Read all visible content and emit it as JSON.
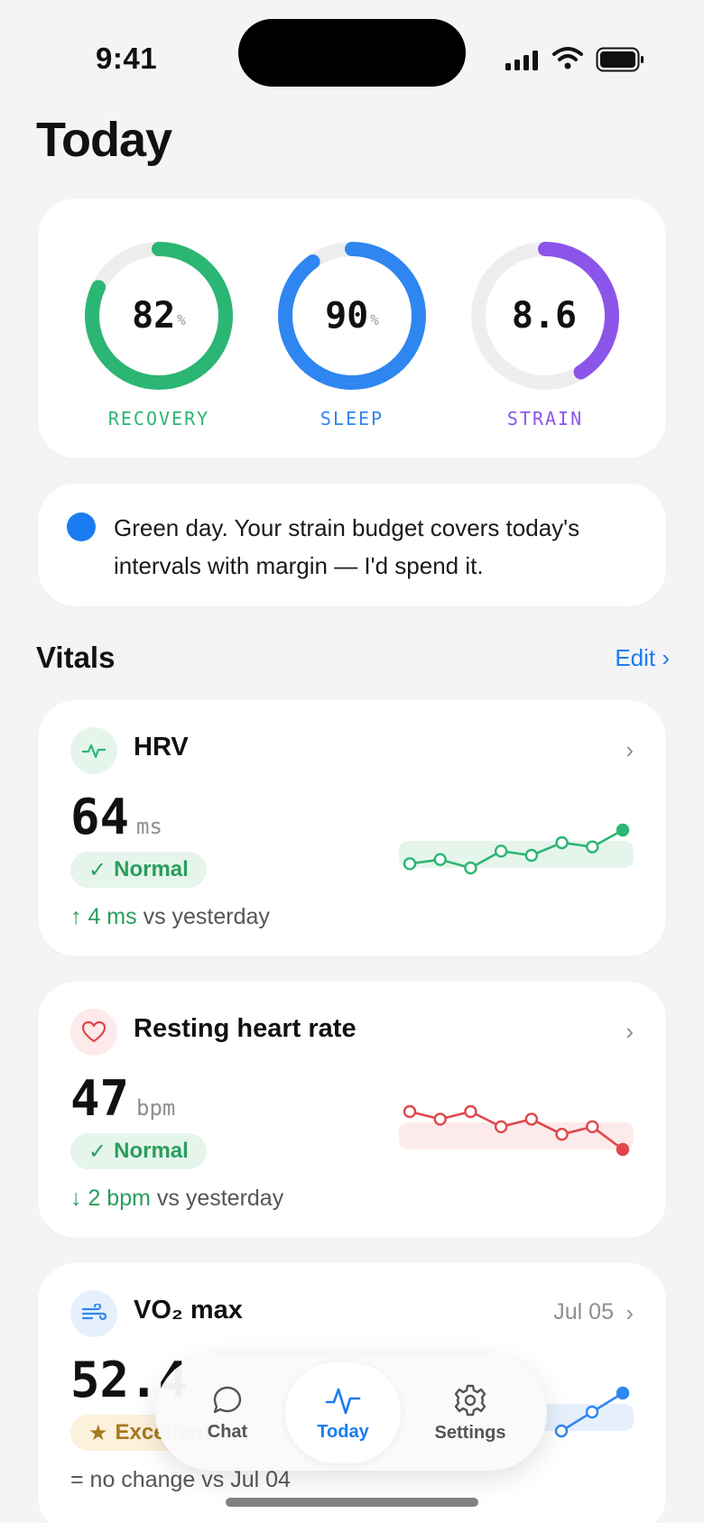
{
  "status_bar": {
    "time": "9:41"
  },
  "page_title": "Today",
  "rings": [
    {
      "value": "82",
      "unit": "%",
      "label": "RECOVERY",
      "progress": 0.82,
      "color": "#2bb673"
    },
    {
      "value": "90",
      "unit": "%",
      "label": "SLEEP",
      "progress": 0.9,
      "color": "#2f86f0"
    },
    {
      "value": "8.6",
      "unit": "",
      "label": "STRAIN",
      "progress": 0.41,
      "color": "#8b55ea"
    }
  ],
  "insight": {
    "text": "Green day. Your strain budget covers today's intervals with margin — I'd spend it."
  },
  "vitals_section": {
    "title": "Vitals",
    "edit_label": "Edit ›"
  },
  "vitals": [
    {
      "name": "HRV",
      "value": "64",
      "unit": "ms",
      "status": "Normal",
      "status_icon": "✓",
      "delta_highlight": "↑ 4 ms",
      "delta_rest": " vs yesterday",
      "date": "",
      "color": "#2bb673",
      "icon": "pulse-icon",
      "trend": [
        3,
        4,
        2,
        6,
        5,
        8,
        7,
        11
      ]
    },
    {
      "name": "Resting heart rate",
      "value": "47",
      "unit": "bpm",
      "status": "Normal",
      "status_icon": "✓",
      "delta_highlight": "↓ 2 bpm",
      "delta_rest": " vs yesterday",
      "date": "",
      "color": "#e0474c",
      "icon": "heart-icon",
      "trend": [
        10,
        9,
        10,
        8,
        9,
        7,
        8,
        5
      ]
    },
    {
      "name": "VO₂ max",
      "value": "52.4",
      "unit": "",
      "status": "Excellent",
      "status_icon": "★",
      "delta_highlight": "",
      "delta_rest": "= no change vs Jul 04",
      "date": "Jul 05",
      "color": "#2f86f0",
      "icon": "wind-icon",
      "trend": [
        5,
        6,
        7
      ]
    }
  ],
  "tab_bar": {
    "tabs": [
      {
        "label": "Chat",
        "icon": "chat-bubble-icon",
        "active": false
      },
      {
        "label": "Today",
        "icon": "activity-icon",
        "active": true
      },
      {
        "label": "Settings",
        "icon": "gear-icon",
        "active": false
      }
    ]
  }
}
